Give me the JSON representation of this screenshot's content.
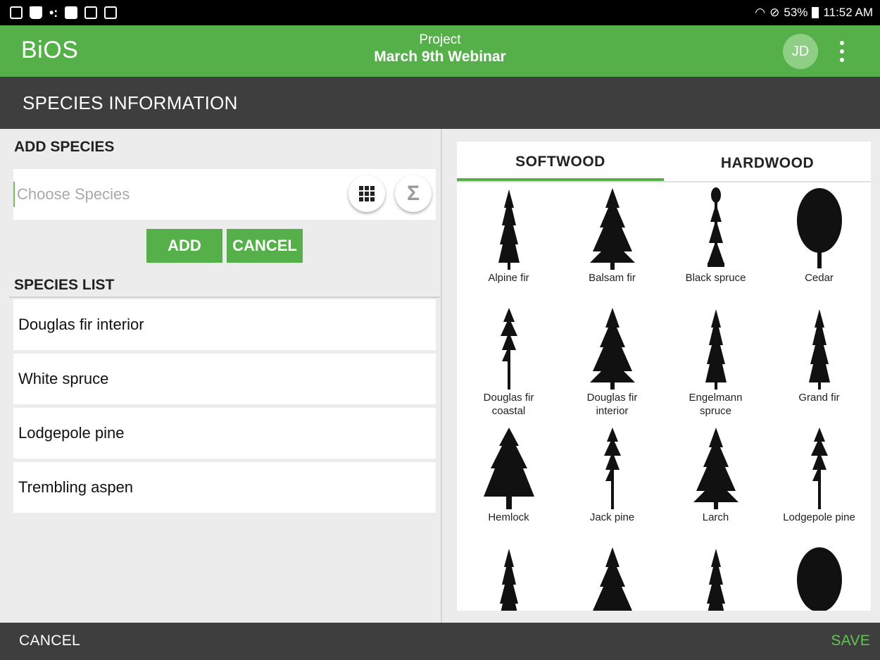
{
  "status_bar": {
    "battery": "53%",
    "time": "11:52 AM"
  },
  "app_bar": {
    "brand": "BiOS",
    "project_label": "Project",
    "project_name": "March 9th Webinar",
    "avatar_initials": "JD",
    "accent_color": "#55b04a"
  },
  "section": {
    "title": "SPECIES INFORMATION"
  },
  "add_species": {
    "heading": "ADD SPECIES",
    "placeholder": "Choose Species",
    "value": "",
    "grid_icon": "grid-icon",
    "sigma_icon": "sigma-icon",
    "sigma_glyph": "Σ",
    "add_label": "ADD",
    "cancel_label": "CANCEL"
  },
  "species_list": {
    "heading": "SPECIES LIST",
    "items": [
      "Douglas fir interior",
      "White spruce",
      "Lodgepole pine",
      "Trembling aspen"
    ]
  },
  "picker": {
    "tabs": [
      {
        "label": "SOFTWOOD",
        "active": true
      },
      {
        "label": "HARDWOOD",
        "active": false
      }
    ],
    "trees": [
      {
        "name": "Alpine fir",
        "shape": "narrow"
      },
      {
        "name": "Balsam fir",
        "shape": "cone"
      },
      {
        "name": "Black spruce",
        "shape": "spire"
      },
      {
        "name": "Cedar",
        "shape": "oval"
      },
      {
        "name": "Douglas fir coastal",
        "shape": "tall-bare"
      },
      {
        "name": "Douglas fir interior",
        "shape": "cone"
      },
      {
        "name": "Engelmann spruce",
        "shape": "narrow"
      },
      {
        "name": "Grand fir",
        "shape": "narrow"
      },
      {
        "name": "Hemlock",
        "shape": "broad-cone"
      },
      {
        "name": "Jack pine",
        "shape": "tall-bare"
      },
      {
        "name": "Larch",
        "shape": "cone"
      },
      {
        "name": "Lodgepole pine",
        "shape": "tall-bare"
      },
      {
        "name": "",
        "shape": "narrow"
      },
      {
        "name": "",
        "shape": "cone"
      },
      {
        "name": "",
        "shape": "narrow"
      },
      {
        "name": "",
        "shape": "oval"
      }
    ]
  },
  "bottom_bar": {
    "cancel_label": "CANCEL",
    "save_label": "SAVE",
    "save_color": "#5fc453"
  }
}
